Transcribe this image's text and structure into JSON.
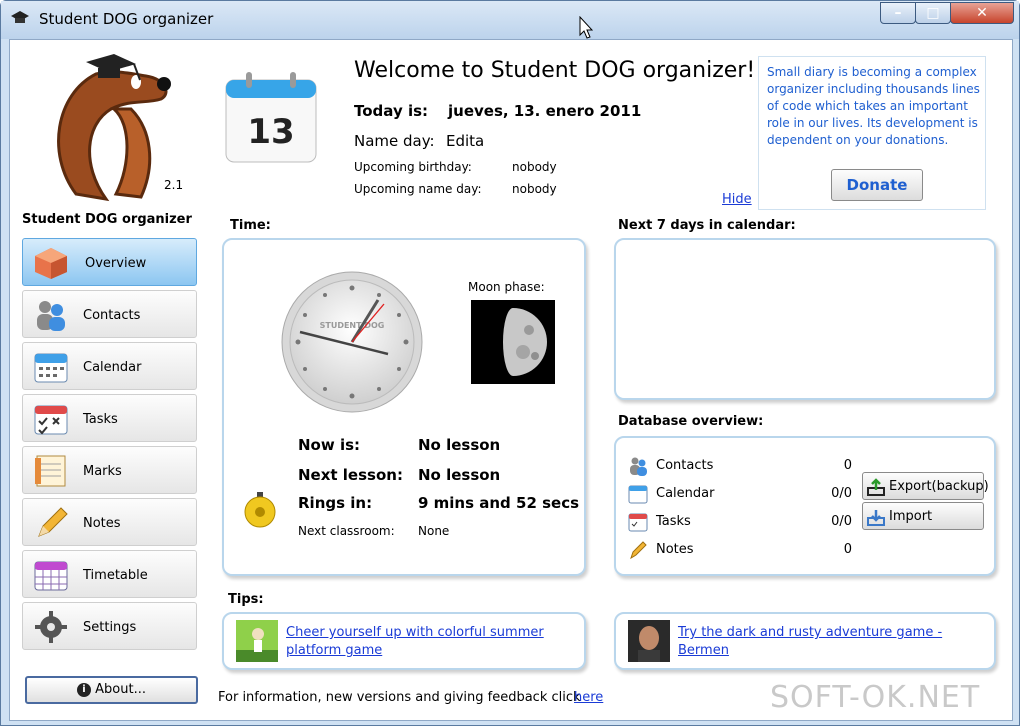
{
  "window": {
    "title": "Student DOG organizer",
    "minimize": "–",
    "maximize": "□",
    "close": "✕"
  },
  "sidebar": {
    "version": "2.1",
    "app_name": "Student DOG organizer",
    "items": [
      {
        "label": "Overview",
        "icon": "cube-icon"
      },
      {
        "label": "Contacts",
        "icon": "contacts-icon"
      },
      {
        "label": "Calendar",
        "icon": "calendar-icon"
      },
      {
        "label": "Tasks",
        "icon": "tasks-icon"
      },
      {
        "label": "Marks",
        "icon": "marks-icon"
      },
      {
        "label": "Notes",
        "icon": "pencil-icon"
      },
      {
        "label": "Timetable",
        "icon": "timetable-icon"
      },
      {
        "label": "Settings",
        "icon": "gear-icon"
      }
    ],
    "about_label": "About..."
  },
  "header": {
    "calendar_day": "13",
    "welcome": "Welcome to Student DOG organizer!",
    "today_label": "Today is:",
    "today_value": "jueves, 13. enero 2011",
    "nameday_label": "Name day:",
    "nameday_value": "Edita",
    "birthday_label": "Upcoming birthday:",
    "birthday_value": "nobody",
    "upnameday_label": "Upcoming name day:",
    "upnameday_value": "nobody",
    "hide_link": "Hide"
  },
  "donate": {
    "text": "Small diary is becoming a complex organizer including thousands lines of code which takes an important role in our lives. Its development is dependent on your donations.",
    "button": "Donate"
  },
  "time": {
    "title": "Time:",
    "clock_brand": "STUDENT DOG",
    "moon_label": "Moon phase:",
    "now_label": "Now is:",
    "now_value": "No lesson",
    "next_label": "Next lesson:",
    "next_value": "No lesson",
    "rings_label": "Rings in:",
    "rings_value": "9 mins and 52 secs",
    "classroom_label": "Next classroom:",
    "classroom_value": "None"
  },
  "calendar_panel": {
    "title": "Next 7 days in calendar:"
  },
  "database": {
    "title": "Database overview:",
    "rows": [
      {
        "label": "Contacts",
        "value": "0"
      },
      {
        "label": "Calendar",
        "value": "0/0"
      },
      {
        "label": "Tasks",
        "value": "0/0"
      },
      {
        "label": "Notes",
        "value": "0"
      }
    ],
    "export_label": "Export(backup)",
    "import_label": "Import"
  },
  "tips": {
    "title": "Tips:",
    "tip1": "Cheer yourself up with colorful summer platform game",
    "tip2": "Try the dark and rusty adventure game - Bermen"
  },
  "footer": {
    "text": "For information, new versions and giving feedback click",
    "link": "here"
  },
  "watermark": "SOFT-OK.NET",
  "colors": {
    "accent": "#1f5fd0",
    "link": "#1a3bd6",
    "active_nav": "#8cc6f1",
    "panel_border": "#b9d6ec"
  }
}
